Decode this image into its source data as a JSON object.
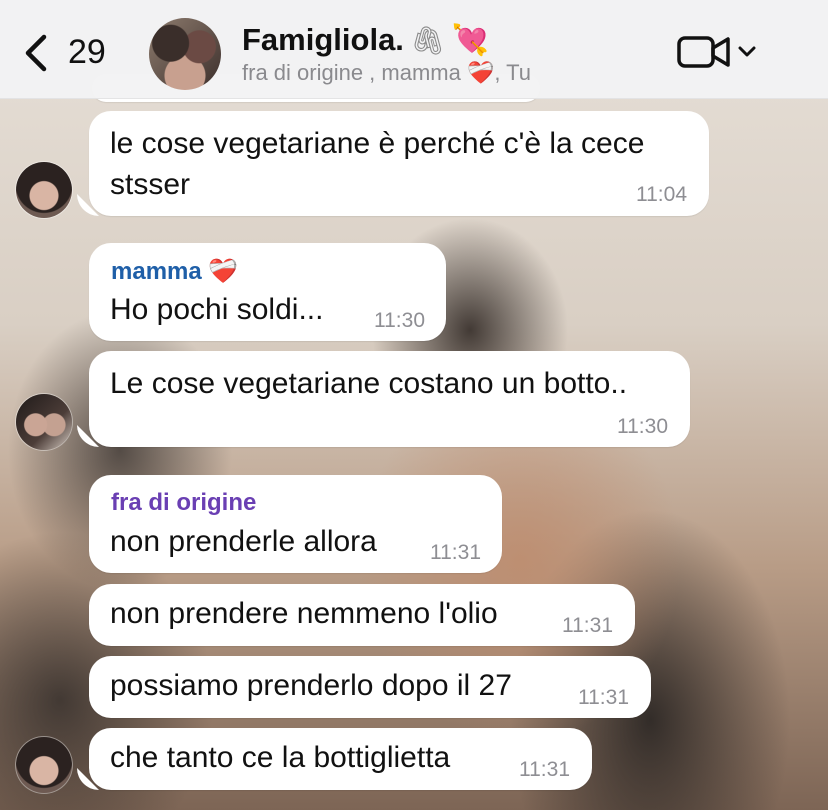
{
  "header": {
    "back_count": "29",
    "title": "Famigliola.",
    "title_emoji_1": "🖇",
    "title_emoji_2": "💘",
    "subtitle": "fra di origine , mamma ❤️‍🩹, Tu"
  },
  "messages": [
    {
      "sender": "",
      "lines": [
        "le cose vegetariane è perché c'è la cece",
        "stsser"
      ],
      "time": "11:04"
    },
    {
      "sender": "mamma ❤️‍🩹",
      "sender_color": "#1f5fa8",
      "lines": [
        "Ho pochi soldi..."
      ],
      "time": "11:30"
    },
    {
      "sender": "",
      "lines": [
        "Le cose vegetariane costano un botto.."
      ],
      "time": "11:30"
    },
    {
      "sender": "fra di origine",
      "sender_color": "#6a3fb3",
      "lines": [
        "non prenderle allora"
      ],
      "time": "11:31"
    },
    {
      "sender": "",
      "lines": [
        "non prendere nemmeno l'olio"
      ],
      "time": "11:31"
    },
    {
      "sender": "",
      "lines": [
        "possiamo prenderlo dopo il 27"
      ],
      "time": "11:31"
    },
    {
      "sender": "",
      "lines": [
        "che tanto ce la bottiglietta"
      ],
      "time": "11:31"
    }
  ],
  "icons": {
    "back": "chevron-left-icon",
    "video": "video-camera-icon",
    "dropdown": "chevron-down-icon"
  }
}
